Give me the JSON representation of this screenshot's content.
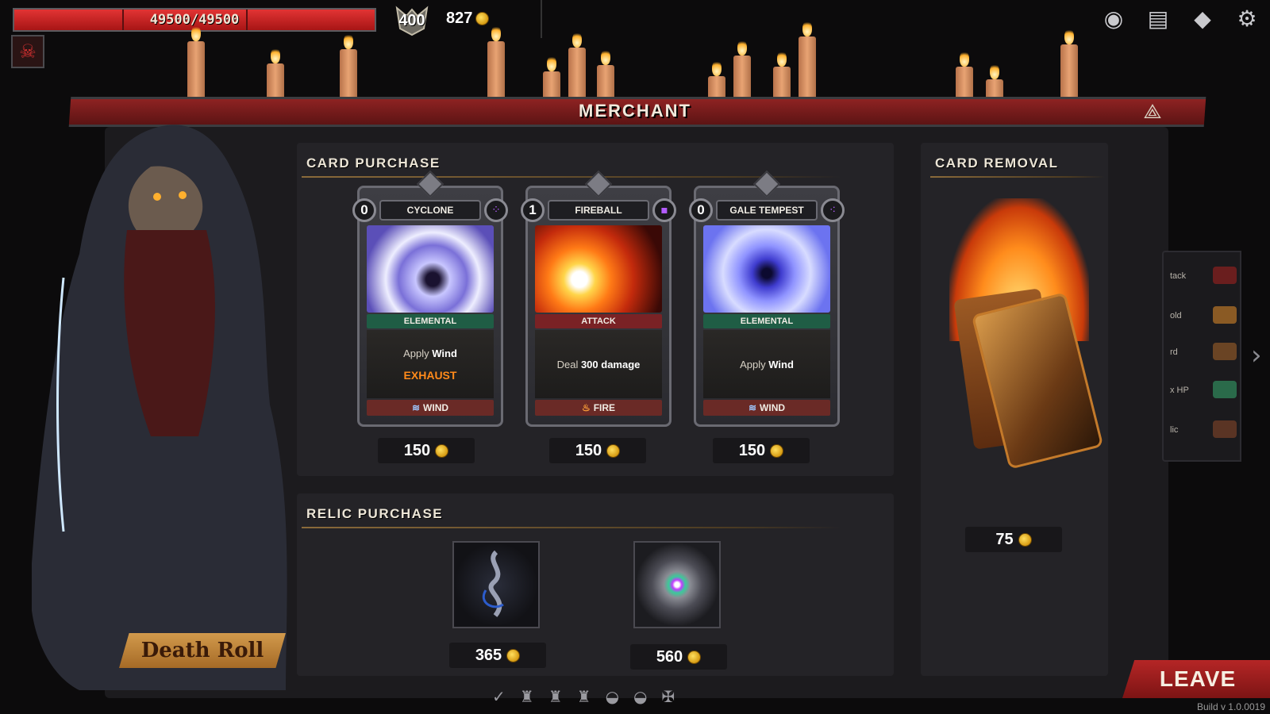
{
  "hud": {
    "hp_text": "49500/49500",
    "hp_fraction": 1.0,
    "energy": "400",
    "gold": "827",
    "icons": [
      "eye-icon",
      "deck-icon",
      "warning-icon",
      "gear-icon"
    ]
  },
  "banner": {
    "title": "MERCHANT"
  },
  "card_purchase": {
    "title": "CARD PURCHASE",
    "cards": [
      {
        "cost": "0",
        "name": "CYCLONE",
        "category": "ELEMENTAL",
        "desc_prefix": "Apply ",
        "desc_bold": "Wind",
        "desc_suffix": "",
        "extra": "EXHAUST",
        "element": "WIND",
        "price": "150"
      },
      {
        "cost": "1",
        "name": "FIREBALL",
        "category": "ATTACK",
        "desc_prefix": "Deal ",
        "desc_bold": "300 damage",
        "desc_suffix": "",
        "extra": "",
        "element": "FIRE",
        "price": "150"
      },
      {
        "cost": "0",
        "name": "GALE TEMPEST",
        "category": "ELEMENTAL",
        "desc_prefix": "Apply ",
        "desc_bold": "Wind",
        "desc_suffix": "",
        "extra": "",
        "element": "WIND",
        "price": "150"
      }
    ]
  },
  "relic_purchase": {
    "title": "RELIC PURCHASE",
    "relics": [
      {
        "price": "365"
      },
      {
        "price": "560"
      }
    ]
  },
  "card_removal": {
    "title": "CARD REMOVAL",
    "price": "75"
  },
  "side_drawer": {
    "rows": [
      "tack",
      "old",
      "rd",
      "x HP",
      "lic"
    ]
  },
  "npc": {
    "name": "Death Roll"
  },
  "leave_label": "LEAVE",
  "build": "Build v 1.0.0019"
}
